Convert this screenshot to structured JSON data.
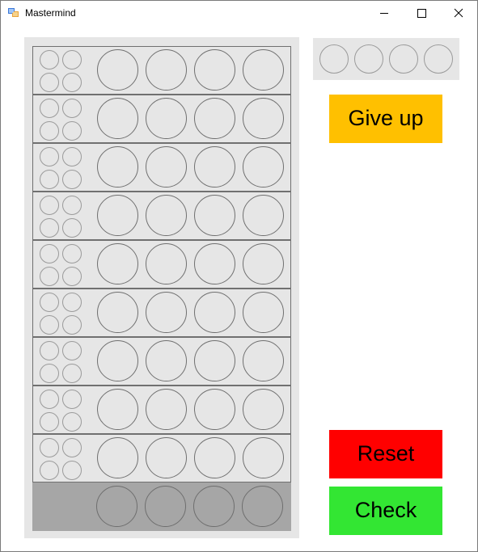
{
  "window": {
    "title": "Mastermind"
  },
  "title_controls": {
    "minimize_icon": "minimize-icon",
    "maximize_icon": "maximize-icon",
    "close_icon": "close-icon"
  },
  "board": {
    "guess_rows": 9,
    "pegs_per_row": 4,
    "hints_per_row": 4
  },
  "palette": {
    "slots": 4
  },
  "buttons": {
    "give_up": "Give up",
    "reset": "Reset",
    "check": "Check"
  },
  "colors": {
    "give_up": "#ffc000",
    "reset": "#ff0000",
    "check": "#33e633",
    "empty_peg": "#e6e6e6",
    "secret_peg": "#a6a6a6"
  }
}
